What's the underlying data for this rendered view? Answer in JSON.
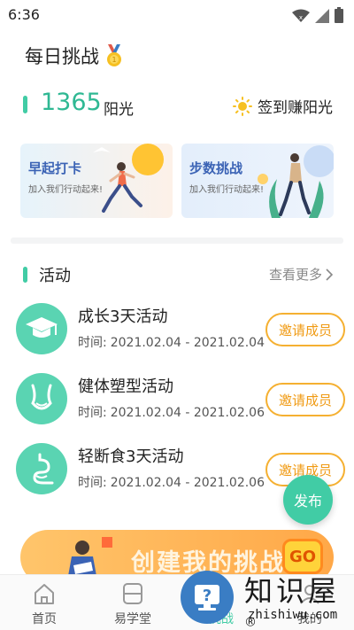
{
  "status_bar": {
    "time": "6:36"
  },
  "header": {
    "title": "每日挑战",
    "medal_icon": "medal-icon"
  },
  "sunshine": {
    "count": "1365",
    "unit": "阳光",
    "checkin_label": "签到赚阳光",
    "checkin_icon": "sun-icon"
  },
  "challenges": [
    {
      "title": "早起打卡",
      "subtitle": "加入我们行动起来!"
    },
    {
      "title": "步数挑战",
      "subtitle": "加入我们行动起来!"
    }
  ],
  "activities_section": {
    "title": "活动",
    "see_more": "查看更多"
  },
  "activities": [
    {
      "name": "成长3天活动",
      "time_label": "时间:",
      "time": "2021.02.04 - 2021.02.04",
      "invite": "邀请成员",
      "icon": "graduation-cap-icon"
    },
    {
      "name": "健体塑型活动",
      "time_label": "时间:",
      "time": "2021.02.04 - 2021.02.06",
      "invite": "邀请成员",
      "icon": "body-shape-icon"
    },
    {
      "name": "轻断食3天活动",
      "time_label": "时间:",
      "time": "2021.02.04 - 2021.02.06",
      "invite": "邀请成员",
      "icon": "stomach-icon"
    }
  ],
  "fab": {
    "label": "发布"
  },
  "banner": {
    "text": "创建我的挑战",
    "go": "GO"
  },
  "tabs": [
    {
      "label": "首页",
      "icon": "home-icon"
    },
    {
      "label": "易学堂",
      "icon": "book-icon"
    },
    {
      "label": "挑战",
      "icon": "challenge-icon"
    },
    {
      "label": "我的",
      "icon": "profile-icon"
    }
  ],
  "watermark": {
    "title": "知识屋",
    "registered": "®",
    "subtitle": "zhishiwu.com"
  },
  "colors": {
    "accent": "#41cca5",
    "invite": "#f5b031",
    "title_blue": "#3b63b5"
  }
}
